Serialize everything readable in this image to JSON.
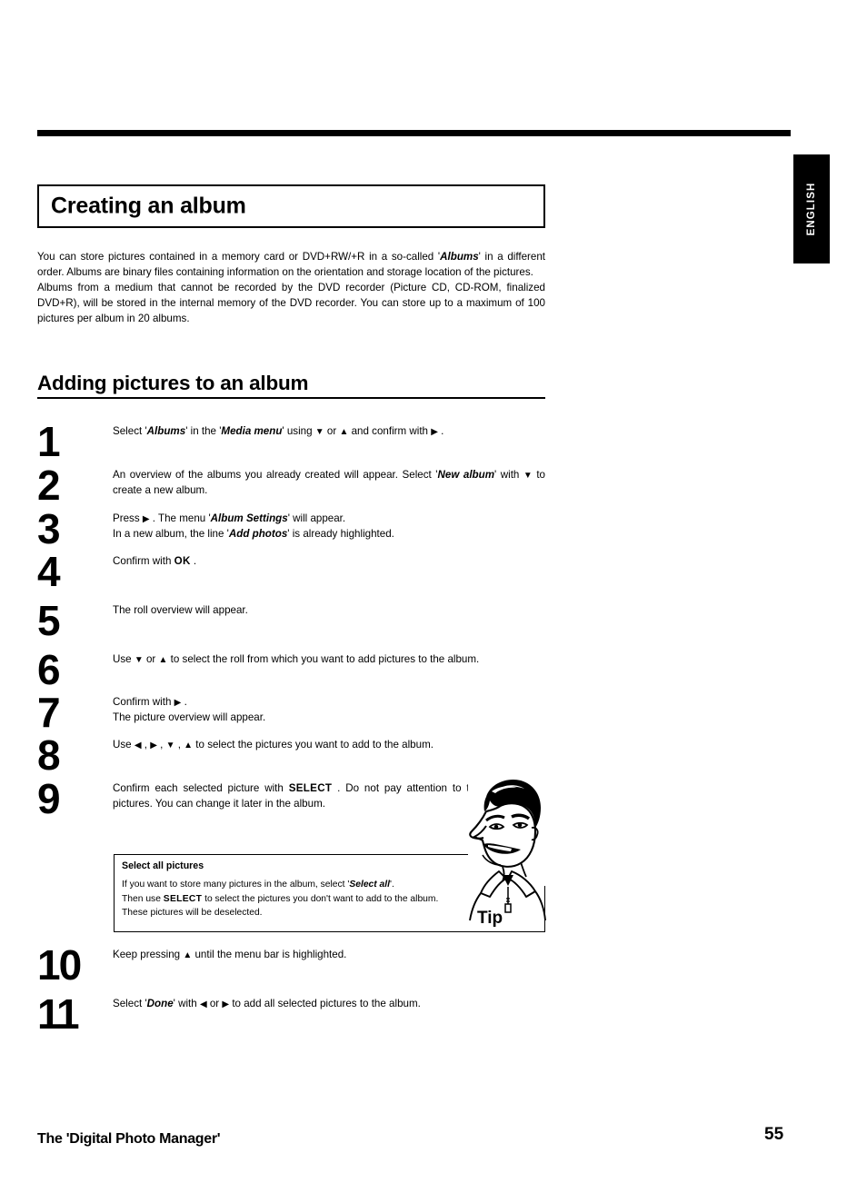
{
  "page": {
    "language_tab": "ENGLISH",
    "chapter_title": "Creating an album",
    "section_title": "Adding pictures to an album",
    "footer_title": "The 'Digital Photo Manager'",
    "page_number": "55"
  },
  "intro": {
    "paragraph1": "You can store pictures contained in a memory card or DVD+RW/+R in a so-called 'Albums' in a different order. Albums are binary files containing information on the orientation and storage location of the pictures.",
    "paragraph2": "Albums from a medium that cannot be recorded by the DVD recorder (Picture CD, CD-ROM, finalized DVD+R), will be stored in the internal memory of the DVD recorder. You can store up to a maximum of 100 pictures per album in 20 albums.",
    "p1_pre": "You can store pictures contained in a memory card or DVD+RW/+R in a so-called '",
    "p1_em": "Albums",
    "p1_post": "' in a different order. Albums are binary files containing information on the orientation and storage location of the pictures."
  },
  "steps": [
    {
      "number": "1",
      "text": "Select 'Albums' in the 'Media menu' using ▼ or ▲ and confirm with ▶ .",
      "pre": "Select '",
      "em1": "Albums",
      "mid1": "' in the '",
      "em2": "Media menu",
      "mid2": "' using ",
      "arrow1": "▼",
      "mid3": " or ",
      "arrow2": "▲",
      "mid4": " and confirm with ",
      "arrow3": "▶",
      "post": " ."
    },
    {
      "number": "2",
      "text": "An overview of the albums you already created will appear. Select 'New album' with ▼ to create a new album.",
      "pre": "An overview of the albums you already created will appear. Select '",
      "em1": "New album",
      "mid1": "' with ",
      "arrow1": "▼",
      "post": " to create a new album."
    },
    {
      "number": "3",
      "line1_pre": "Press ",
      "line1_arrow": "▶",
      "line1_mid": " . The menu '",
      "line1_em": "Album Settings",
      "line1_post": "' will appear.",
      "line2_pre": "In a new album, the line '",
      "line2_em": "Add photos",
      "line2_post": "' is already highlighted."
    },
    {
      "number": "4",
      "pre": "Confirm with  ",
      "key": "OK",
      "post": " ."
    },
    {
      "number": "5",
      "text": "The roll overview will appear."
    },
    {
      "number": "6",
      "pre": "Use  ",
      "arrow1": "▼",
      "mid1": " or  ",
      "arrow2": "▲",
      "post": " to select the roll from which you want to add pictures to the album."
    },
    {
      "number": "7",
      "line1_pre": "Confirm with ",
      "line1_arrow": "▶",
      "line1_post": " .",
      "line2": "The picture overview will appear."
    },
    {
      "number": "8",
      "pre": "Use  ",
      "arrow1": "◀",
      "mid1": " ,  ",
      "arrow2": "▶",
      "mid2": " ,  ",
      "arrow3": "▼",
      "mid3": " ,  ",
      "arrow4": "▲",
      "post": " to select the pictures you want to add to the album."
    },
    {
      "number": "9",
      "pre": "Confirm each selected picture with  ",
      "key": "SELECT",
      "post": " . Do not pay attention to the order of the pictures. You can change it later in the album."
    }
  ],
  "tip": {
    "label": "Tip",
    "title": "Select all pictures",
    "line1_pre": "If you want to store many pictures in the album, select '",
    "line1_em": "Select all",
    "line1_post": "'.",
    "line2_pre": "Then use  ",
    "line2_key": "SELECT",
    "line2_post": " to select the pictures you don't want to add to the album.",
    "line3": "These pictures will be deselected."
  },
  "steps_late": [
    {
      "number": "10",
      "pre": "Keep pressing  ",
      "arrow1": "▲",
      "post": " until the menu bar is highlighted."
    },
    {
      "number": "11",
      "pre": "Select '",
      "em1": "Done",
      "mid1": "' with  ",
      "arrow1": "◀",
      "mid2": " or ",
      "arrow2": "▶",
      "post": " to add all selected pictures to the album."
    }
  ],
  "colors": {
    "ink": "#000000",
    "paper": "#ffffff",
    "tab_background": "#000000",
    "tab_text": "#ffffff"
  }
}
